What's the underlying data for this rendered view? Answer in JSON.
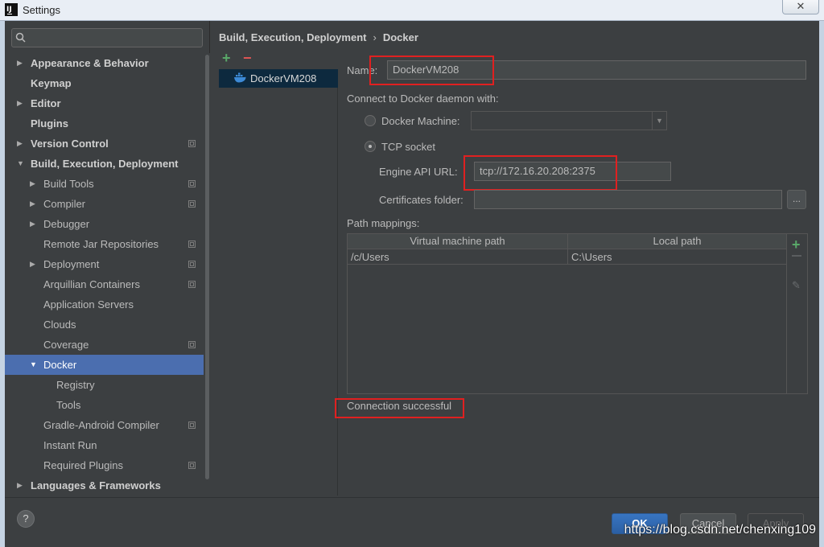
{
  "window": {
    "title": "Settings",
    "close_glyph": "✕",
    "app_icon": "intellij-icon",
    "app_icon_text": "IJ"
  },
  "search": {
    "value": "",
    "icon": "search-icon"
  },
  "tree": [
    {
      "label": "Appearance & Behavior",
      "level": 0,
      "expander": "collapsed",
      "bold": true,
      "project": false
    },
    {
      "label": "Keymap",
      "level": 0,
      "expander": "none",
      "bold": true,
      "project": false
    },
    {
      "label": "Editor",
      "level": 0,
      "expander": "collapsed",
      "bold": true,
      "project": false
    },
    {
      "label": "Plugins",
      "level": 0,
      "expander": "none",
      "bold": true,
      "project": false
    },
    {
      "label": "Version Control",
      "level": 0,
      "expander": "collapsed",
      "bold": true,
      "project": true
    },
    {
      "label": "Build, Execution, Deployment",
      "level": 0,
      "expander": "expanded",
      "bold": true,
      "project": false
    },
    {
      "label": "Build Tools",
      "level": 1,
      "expander": "collapsed",
      "bold": false,
      "project": true
    },
    {
      "label": "Compiler",
      "level": 1,
      "expander": "collapsed",
      "bold": false,
      "project": true
    },
    {
      "label": "Debugger",
      "level": 1,
      "expander": "collapsed",
      "bold": false,
      "project": false
    },
    {
      "label": "Remote Jar Repositories",
      "level": 1,
      "expander": "none",
      "bold": false,
      "project": true
    },
    {
      "label": "Deployment",
      "level": 1,
      "expander": "collapsed",
      "bold": false,
      "project": true
    },
    {
      "label": "Arquillian Containers",
      "level": 1,
      "expander": "none",
      "bold": false,
      "project": true
    },
    {
      "label": "Application Servers",
      "level": 1,
      "expander": "none",
      "bold": false,
      "project": false
    },
    {
      "label": "Clouds",
      "level": 1,
      "expander": "none",
      "bold": false,
      "project": false
    },
    {
      "label": "Coverage",
      "level": 1,
      "expander": "none",
      "bold": false,
      "project": true
    },
    {
      "label": "Docker",
      "level": 1,
      "expander": "expanded",
      "bold": false,
      "project": false,
      "selected": true
    },
    {
      "label": "Registry",
      "level": 2,
      "expander": "none",
      "bold": false,
      "project": false
    },
    {
      "label": "Tools",
      "level": 2,
      "expander": "none",
      "bold": false,
      "project": false
    },
    {
      "label": "Gradle-Android Compiler",
      "level": 1,
      "expander": "none",
      "bold": false,
      "project": true
    },
    {
      "label": "Instant Run",
      "level": 1,
      "expander": "none",
      "bold": false,
      "project": false
    },
    {
      "label": "Required Plugins",
      "level": 1,
      "expander": "none",
      "bold": false,
      "project": true
    },
    {
      "label": "Languages & Frameworks",
      "level": 0,
      "expander": "collapsed",
      "bold": true,
      "project": false
    }
  ],
  "breadcrumb": {
    "parent": "Build, Execution, Deployment",
    "separator": "›",
    "current": "Docker"
  },
  "list_toolbar": {
    "add": "+",
    "remove": "−"
  },
  "servers": [
    {
      "name": "DockerVM208",
      "icon": "docker-whale-icon"
    }
  ],
  "form": {
    "name_label": "Name:",
    "name_value": "DockerVM208",
    "connect_label": "Connect to Docker daemon with:",
    "docker_machine_label": "Docker Machine:",
    "docker_machine_value": "",
    "tcp_label": "TCP socket",
    "selected_option": "tcp",
    "engine_url_label": "Engine API URL:",
    "engine_url_value": "tcp://172.16.20.208:2375",
    "certs_label": "Certificates folder:",
    "certs_value": "",
    "browse_label": "...",
    "path_mappings_label": "Path mappings:"
  },
  "path_table": {
    "columns": [
      "Virtual machine path",
      "Local path"
    ],
    "rows": [
      [
        "/c/Users",
        "C:\\Users"
      ]
    ],
    "add": "+",
    "edit_icon": "pencil-icon"
  },
  "status": {
    "text": "Connection successful"
  },
  "buttons": {
    "help": "?",
    "ok": "OK",
    "cancel": "Cancel",
    "apply": "Apply"
  },
  "watermark": "https://blog.csdn.net/chenxing109",
  "colors": {
    "selection": "#4b6eaf",
    "highlight_box": "#e02020",
    "add_green": "#59a869",
    "remove_red": "#e05555",
    "background": "#3c3f41"
  }
}
